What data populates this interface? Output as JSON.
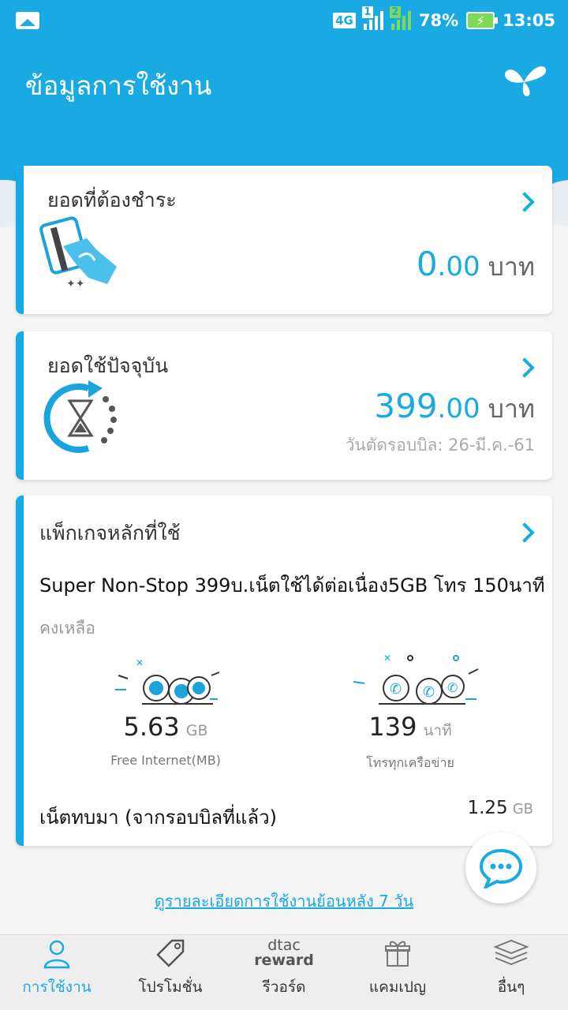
{
  "status_bar": {
    "network": "4G",
    "sim1": "1",
    "sim2": "2",
    "battery": "78%",
    "time": "13:05",
    "colors": {
      "bg": "#19aae4",
      "signal_sim2": "#7ed957"
    }
  },
  "header": {
    "title": "ข้อมูลการใช้งาน",
    "logo_icon": "dtac-logo-icon"
  },
  "cards": {
    "payment_due": {
      "title": "ยอดที่ต้องชำระ",
      "amount_int": "0",
      "amount_dec": ".00",
      "currency": "บาท",
      "icon": "card-payment-icon"
    },
    "current_usage": {
      "title": "ยอดใช้ปัจจุบัน",
      "amount_int": "399",
      "amount_dec": ".00",
      "currency": "บาท",
      "cut_date": "วันตัดรอบบิล: 26-มี.ค.-61",
      "icon": "hourglass-cycle-icon"
    },
    "main_package": {
      "title": "แพ็กเกจหลักที่ใช้",
      "package_name": "Super Non-Stop 399บ.เน็ตใช้ได้ต่อเนื่อง5GB โทร 150นาที",
      "remaining_label": "คงเหลือ",
      "internet": {
        "value": "5.63",
        "unit": "GB",
        "label": "Free Internet(MB)",
        "icon": "internet-globes-icon"
      },
      "calls": {
        "value": "139",
        "unit": "นาที",
        "label": "โทรทุกเครือข่าย",
        "icon": "phone-calls-icon"
      },
      "rollover": {
        "label": "เน็ตทบมา (จากรอบบิลที่แล้ว)",
        "value": "1.25",
        "unit": "GB"
      }
    }
  },
  "links": {
    "history": "ดูรายละเอียดการใช้งานย้อนหลัง 7 วัน"
  },
  "bottom_nav": [
    {
      "label": "การใช้งาน",
      "icon": "person-icon",
      "active": true
    },
    {
      "label": "โปรโมชั่น",
      "icon": "tag-icon",
      "active": false
    },
    {
      "label": "รีวอร์ด",
      "icon": "dtac-reward-logo",
      "logo_top": "dtac",
      "logo_bottom": "reward",
      "active": false
    },
    {
      "label": "แคมเปญ",
      "icon": "gift-box-icon",
      "active": false
    },
    {
      "label": "อื่นๆ",
      "icon": "layers-icon",
      "active": false
    }
  ],
  "accent_color": "#19aae4"
}
